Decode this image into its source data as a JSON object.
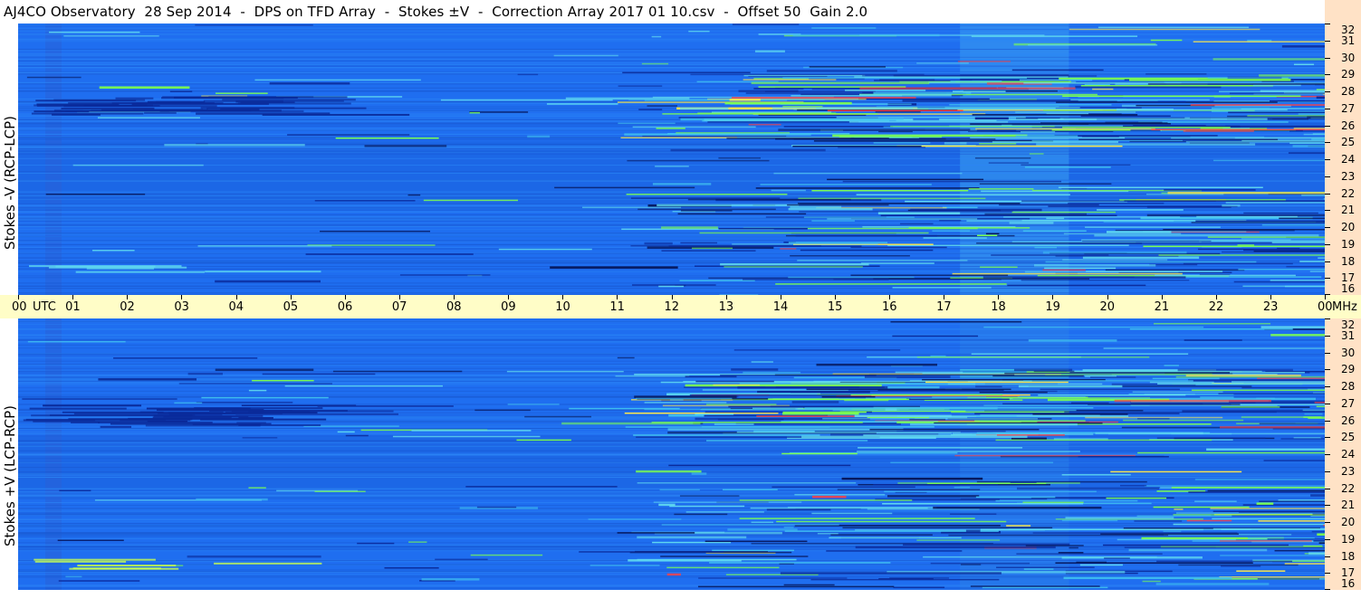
{
  "chart_data": [
    {
      "type": "heatmap",
      "title": "AJ4CO Observatory  28 Sep 2014  -  DPS on TFD Array  -  Stokes ±V  -  Correction Array 2017 01 10.csv  -  Offset 50  Gain 2.0",
      "ylabel": "Stokes -V (RCP-LCP)",
      "xlabel": "UTC",
      "x_ticks": [
        "00",
        "01",
        "02",
        "03",
        "04",
        "05",
        "06",
        "07",
        "08",
        "09",
        "10",
        "11",
        "12",
        "13",
        "14",
        "15",
        "16",
        "17",
        "18",
        "19",
        "20",
        "21",
        "22",
        "23",
        "00"
      ],
      "y_ticks": [
        "32",
        "31",
        "30",
        "29",
        "28",
        "27",
        "26",
        "25",
        "24",
        "23",
        "22",
        "21",
        "20",
        "19",
        "18",
        "17",
        "16"
      ],
      "ylim": [
        16,
        32
      ],
      "xlim": [
        0,
        24
      ],
      "y_unit": "MHz",
      "colors": {
        "background": "#1f6ef0",
        "low": "#0a2a9a",
        "high": "#7cff50",
        "peak": "#ff4040"
      }
    },
    {
      "type": "heatmap",
      "ylabel": "Stokes +V (LCP-RCP)",
      "xlabel": "UTC",
      "x_ticks": [
        "00",
        "01",
        "02",
        "03",
        "04",
        "05",
        "06",
        "07",
        "08",
        "09",
        "10",
        "11",
        "12",
        "13",
        "14",
        "15",
        "16",
        "17",
        "18",
        "19",
        "20",
        "21",
        "22",
        "23",
        "00"
      ],
      "y_ticks": [
        "32",
        "31",
        "30",
        "29",
        "28",
        "27",
        "26",
        "25",
        "24",
        "23",
        "22",
        "21",
        "20",
        "19",
        "18",
        "17",
        "16"
      ],
      "ylim": [
        16,
        32
      ],
      "xlim": [
        0,
        24
      ],
      "y_unit": "MHz",
      "colors": {
        "background": "#1f6ef0",
        "low": "#0a2a9a",
        "high": "#7cff50",
        "peak": "#ff4040"
      }
    }
  ],
  "axis": {
    "utc_label": "UTC",
    "mhz_label": "MHz"
  }
}
